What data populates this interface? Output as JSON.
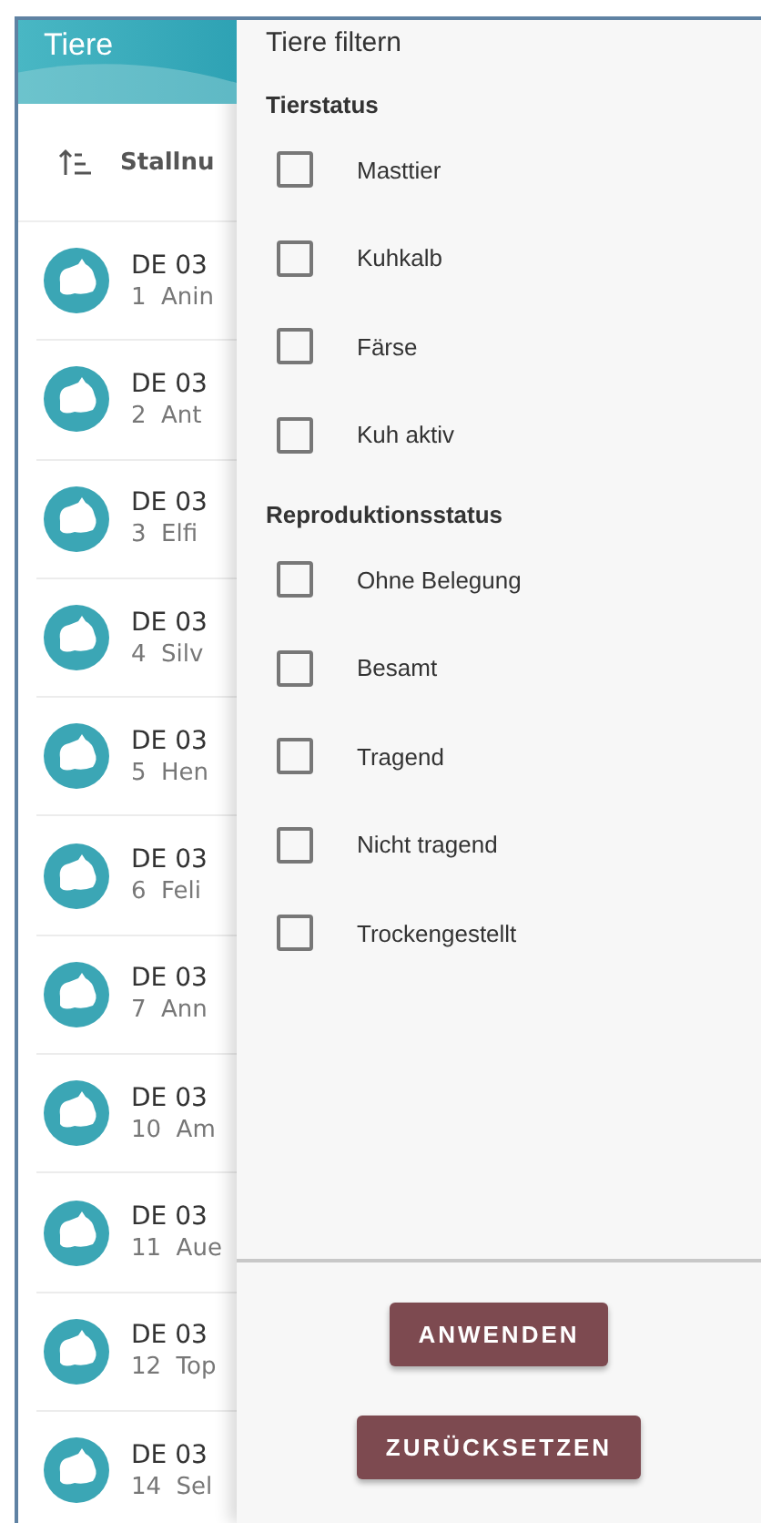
{
  "list": {
    "title": "Tiere",
    "sort_label": "Stallnu",
    "animals": [
      {
        "id": "DE 03",
        "number": "1",
        "name": "Anin"
      },
      {
        "id": "DE 03",
        "number": "2",
        "name": "Ant"
      },
      {
        "id": "DE 03",
        "number": "3",
        "name": "Elfi"
      },
      {
        "id": "DE 03",
        "number": "4",
        "name": "Silv"
      },
      {
        "id": "DE 03",
        "number": "5",
        "name": "Hen"
      },
      {
        "id": "DE 03",
        "number": "6",
        "name": "Feli"
      },
      {
        "id": "DE 03",
        "number": "7",
        "name": "Ann"
      },
      {
        "id": "DE 03",
        "number": "10",
        "name": "Am"
      },
      {
        "id": "DE 03",
        "number": "11",
        "name": "Aue"
      },
      {
        "id": "DE 03",
        "number": "12",
        "name": "Top"
      },
      {
        "id": "DE 03",
        "number": "14",
        "name": "Sel"
      }
    ]
  },
  "filter": {
    "title": "Tiere filtern",
    "sections": [
      {
        "heading": "Tierstatus",
        "options": [
          {
            "label": "Masttier",
            "checked": false
          },
          {
            "label": "Kuhkalb",
            "checked": false
          },
          {
            "label": "Färse",
            "checked": false
          },
          {
            "label": "Kuh aktiv",
            "checked": false
          }
        ]
      },
      {
        "heading": "Reproduktionsstatus",
        "options": [
          {
            "label": "Ohne Belegung",
            "checked": false
          },
          {
            "label": "Besamt",
            "checked": false
          },
          {
            "label": "Tragend",
            "checked": false
          },
          {
            "label": "Nicht tragend",
            "checked": false
          },
          {
            "label": "Trockengestellt",
            "checked": false
          }
        ]
      }
    ],
    "buttons": [
      "ANWENDEN",
      "ZURÜCKSETZEN"
    ]
  }
}
